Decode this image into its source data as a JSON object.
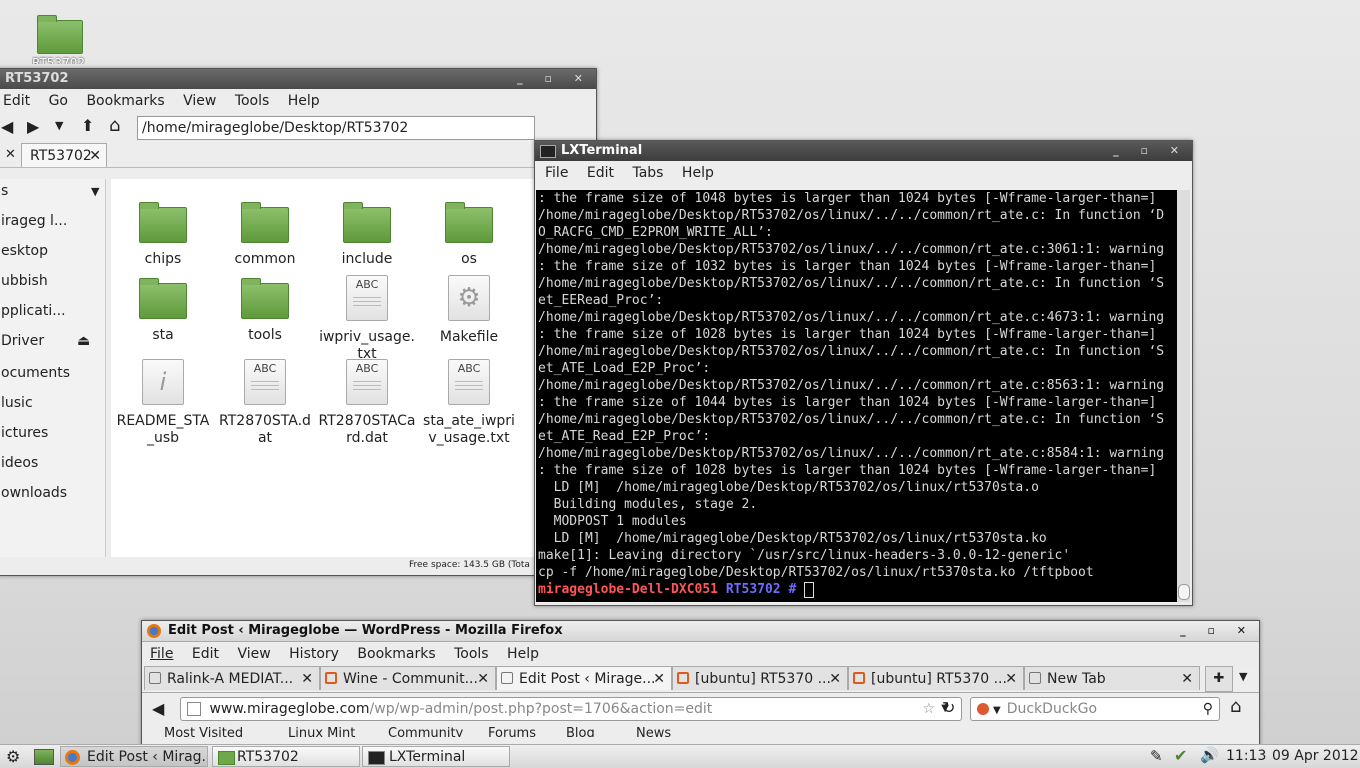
{
  "desktop": {
    "icon_label": "RT53702"
  },
  "file_manager": {
    "title": "RT53702",
    "menu": [
      "Edit",
      "Go",
      "Bookmarks",
      "View",
      "Tools",
      "Help"
    ],
    "path": "/home/mirageglobe/Desktop/RT53702",
    "tab_label": "RT53702",
    "sidebar": [
      "mirageglobe",
      "Desktop",
      "Rubbish",
      "Applications",
      "Driver",
      "Documents",
      "Music",
      "Pictures",
      "Videos",
      "Downloads"
    ],
    "sidebar_visible": [
      "irageg l...",
      "esktop",
      "ubbish",
      "pplicati...",
      "Driver",
      "ocuments",
      "lusic",
      "ictures",
      "ideos",
      "ownloads"
    ],
    "files": [
      {
        "name": "chips",
        "type": "folder"
      },
      {
        "name": "common",
        "type": "folder"
      },
      {
        "name": "include",
        "type": "folder"
      },
      {
        "name": "os",
        "type": "folder"
      },
      {
        "name": "sta",
        "type": "folder"
      },
      {
        "name": "tools",
        "type": "folder"
      },
      {
        "name": "iwpriv_usage.\ntxt",
        "type": "text"
      },
      {
        "name": "Makefile",
        "type": "makefile"
      },
      {
        "name": "README_STA\n_usb",
        "type": "info"
      },
      {
        "name": "RT2870STA.d\nat",
        "type": "text"
      },
      {
        "name": "RT2870STACa\nrd.dat",
        "type": "text"
      },
      {
        "name": "sta_ate_iwpri\nv_usage.txt",
        "type": "text"
      }
    ],
    "status": "Free space: 143.5 GB (Tota"
  },
  "terminal": {
    "title": "LXTerminal",
    "menu": [
      "File",
      "Edit",
      "Tabs",
      "Help"
    ],
    "lines": [
      ": the frame size of 1048 bytes is larger than 1024 bytes [-Wframe-larger-than=]",
      "/home/mirageglobe/Desktop/RT53702/os/linux/../../common/rt_ate.c: In function ‘D",
      "O_RACFG_CMD_E2PROM_WRITE_ALL’:",
      "/home/mirageglobe/Desktop/RT53702/os/linux/../../common/rt_ate.c:3061:1: warning",
      ": the frame size of 1032 bytes is larger than 1024 bytes [-Wframe-larger-than=]",
      "/home/mirageglobe/Desktop/RT53702/os/linux/../../common/rt_ate.c: In function ‘S",
      "et_EERead_Proc’:",
      "/home/mirageglobe/Desktop/RT53702/os/linux/../../common/rt_ate.c:4673:1: warning",
      ": the frame size of 1028 bytes is larger than 1024 bytes [-Wframe-larger-than=]",
      "/home/mirageglobe/Desktop/RT53702/os/linux/../../common/rt_ate.c: In function ‘S",
      "et_ATE_Load_E2P_Proc’:",
      "/home/mirageglobe/Desktop/RT53702/os/linux/../../common/rt_ate.c:8563:1: warning",
      ": the frame size of 1044 bytes is larger than 1024 bytes [-Wframe-larger-than=]",
      "/home/mirageglobe/Desktop/RT53702/os/linux/../../common/rt_ate.c: In function ‘S",
      "et_ATE_Read_E2P_Proc’:",
      "/home/mirageglobe/Desktop/RT53702/os/linux/../../common/rt_ate.c:8584:1: warning",
      ": the frame size of 1028 bytes is larger than 1024 bytes [-Wframe-larger-than=]",
      "  LD [M]  /home/mirageglobe/Desktop/RT53702/os/linux/rt5370sta.o",
      "  Building modules, stage 2.",
      "  MODPOST 1 modules",
      "  LD [M]  /home/mirageglobe/Desktop/RT53702/os/linux/rt5370sta.ko",
      "make[1]: Leaving directory `/usr/src/linux-headers-3.0.0-12-generic'",
      "cp -f /home/mirageglobe/Desktop/RT53702/os/linux/rt5370sta.ko /tftpboot"
    ],
    "prompt_user": "mirageglobe-Dell-DXC051",
    "prompt_dir": "RT53702",
    "prompt_symbol": "#"
  },
  "firefox": {
    "title": "Edit Post ‹ Mirageglobe — WordPress - Mozilla Firefox",
    "menu": [
      "File",
      "Edit",
      "View",
      "History",
      "Bookmarks",
      "Tools",
      "Help"
    ],
    "tabs": [
      {
        "label": "Ralink-A MEDIAT...",
        "icon": "page"
      },
      {
        "label": "Wine - Communit...",
        "icon": "ubuntu"
      },
      {
        "label": "Edit Post ‹ Mirage...",
        "icon": "page",
        "selected": true
      },
      {
        "label": "[ubuntu] RT5370 ...",
        "icon": "ubuntu"
      },
      {
        "label": "[ubuntu] RT5370 ...",
        "icon": "ubuntu"
      },
      {
        "label": "New Tab",
        "icon": "page"
      }
    ],
    "url_domain": "www.mirageglobe.com",
    "url_path": "/wp/wp-admin/post.php?post=1706&action=edit",
    "search_placeholder": "DuckDuckGo",
    "bookmarks": [
      "Most Visited",
      "Linux Mint",
      "Community",
      "Forums",
      "Blog",
      "News"
    ]
  },
  "taskbar": {
    "items": [
      "Edit Post ‹ Mirag...",
      "RT53702",
      "LXTerminal"
    ],
    "time": "11:13",
    "date": "09 Apr 2012"
  },
  "colors": {
    "prompt_user": "#ff5555",
    "prompt_dir": "#5c5cff",
    "folder_green": "#6ea84a"
  }
}
